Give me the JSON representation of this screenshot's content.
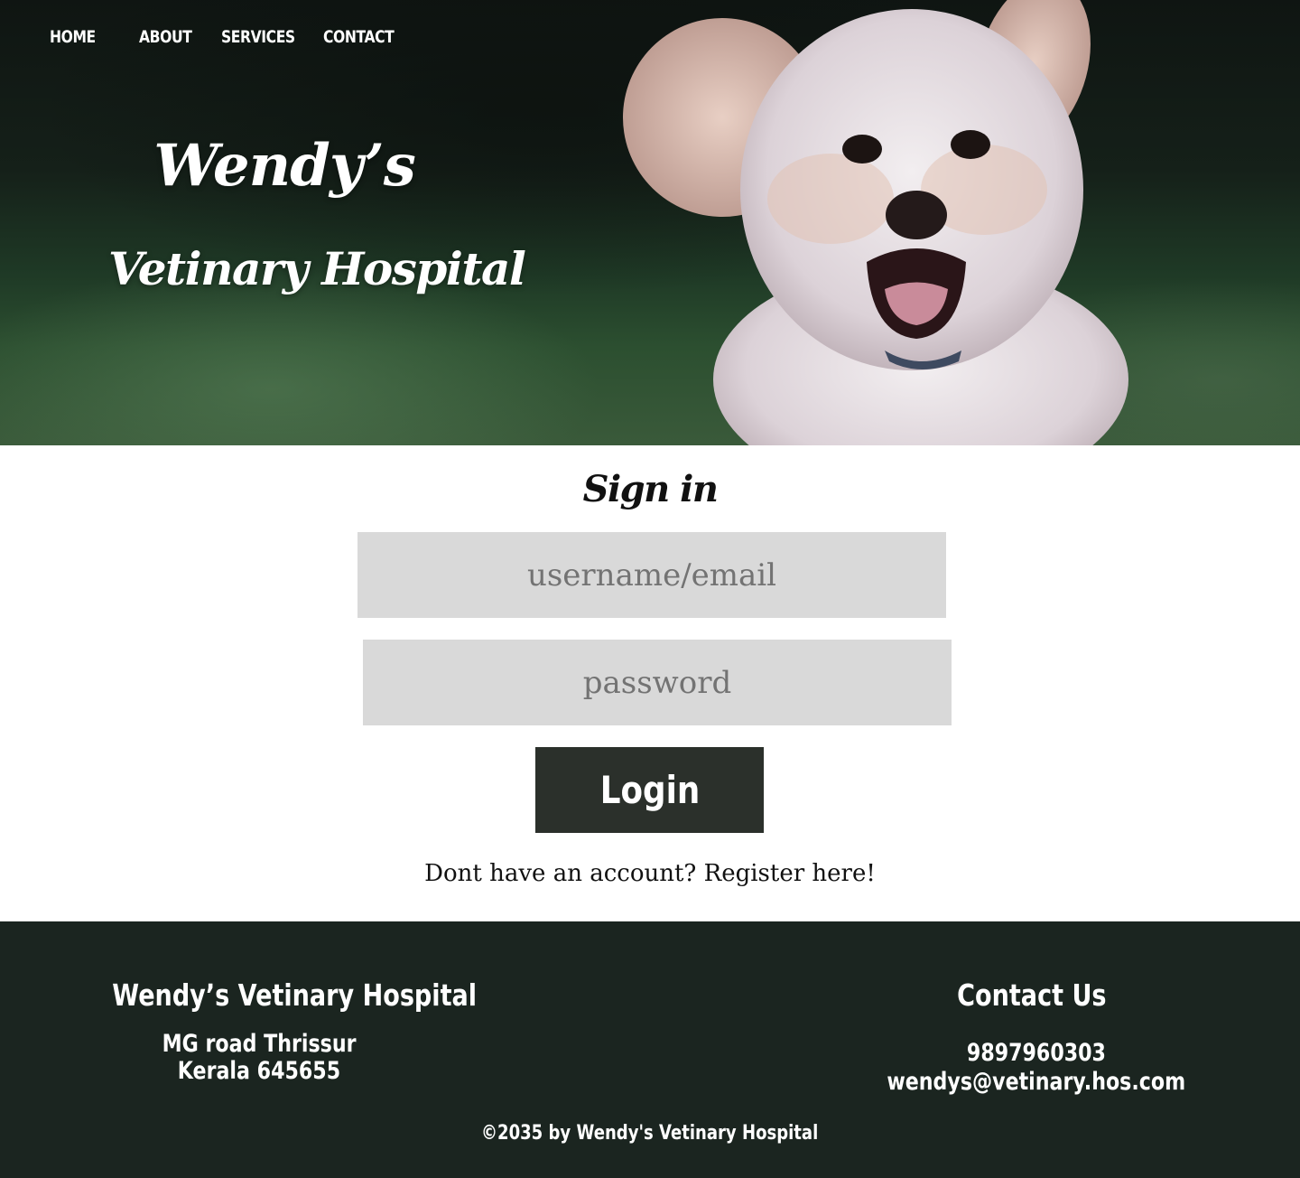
{
  "nav": {
    "items": [
      {
        "label": "HOME"
      },
      {
        "label": "ABOUT"
      },
      {
        "label": "SERVICES"
      },
      {
        "label": "CONTACT"
      }
    ]
  },
  "hero": {
    "title": "Wendy’s",
    "subtitle": "Vetinary Hospital"
  },
  "signin": {
    "heading": "Sign in",
    "username_placeholder": "username/email",
    "password_placeholder": "password",
    "login_label": "Login",
    "register_text": "Dont have an account? Register here!"
  },
  "footer": {
    "brand": "Wendy’s Vetinary Hospital",
    "address_line1": "MG road Thrissur",
    "address_line2": "Kerala 645655",
    "contact_heading": "Contact Us",
    "phone": "9897960303",
    "email": "wendys@vetinary.hos.com",
    "copyright": "©2035 by Wendy's Vetinary Hospital"
  },
  "colors": {
    "footer_bg": "#1b2520",
    "button_bg": "#2b302b",
    "field_bg": "#d9d9d9"
  }
}
